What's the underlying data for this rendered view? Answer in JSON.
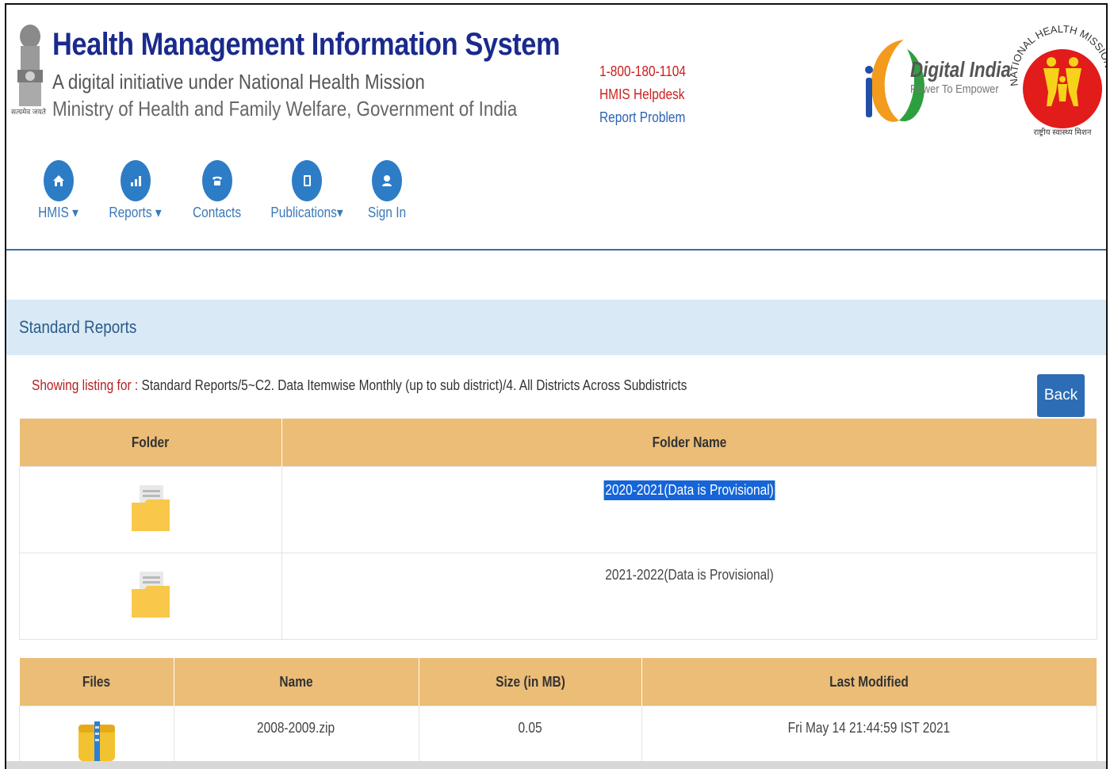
{
  "header": {
    "title": "Health Management Information System",
    "subtitle": "A digital initiative under National Health Mission",
    "ministry": "Ministry of Health and Family Welfare, Government of India",
    "emblem_caption": "सत्यमेव जयते",
    "helpline": {
      "phone": "1-800-180-1104",
      "helpdesk": "HMIS Helpdesk",
      "report_problem": "Report Problem"
    },
    "digital_india": {
      "title": "Digital India",
      "tagline": "Power To Empower"
    },
    "nhm_logo": {
      "text": "NATIONAL HEALTH MISSION",
      "hindi": "राष्ट्रीय स्वास्थ्य मिशन"
    }
  },
  "nav": {
    "items": [
      {
        "label": "HMIS",
        "icon": "home-icon",
        "dropdown": true
      },
      {
        "label": "Reports",
        "icon": "bar-chart-icon",
        "dropdown": true
      },
      {
        "label": "Contacts",
        "icon": "phone-icon",
        "dropdown": false
      },
      {
        "label": "Publications",
        "icon": "book-icon",
        "dropdown": true
      },
      {
        "label": "Sign In",
        "icon": "user-icon",
        "dropdown": false
      }
    ]
  },
  "panel": {
    "title": "Standard Reports",
    "listing_label": "Showing listing for :",
    "listing_path": "Standard Reports/5~C2. Data Itemwise Monthly (up to sub district)/4. All Districts Across Subdistricts",
    "back_label": "Back"
  },
  "folders_table": {
    "headers": [
      "Folder",
      "Folder Name"
    ],
    "rows": [
      {
        "name": "2020-2021(Data is Provisional)",
        "selected": true
      },
      {
        "name": "2021-2022(Data is Provisional)",
        "selected": false
      }
    ]
  },
  "files_table": {
    "headers": [
      "Files",
      "Name",
      "Size (in MB)",
      "Last Modified"
    ],
    "rows": [
      {
        "name": "2008-2009.zip",
        "size": "0.05",
        "modified": "Fri May 14 21:44:59 IST 2021"
      }
    ]
  },
  "colors": {
    "title": "#1a2a8c",
    "nav_icon": "#2d7cc6",
    "table_header": "#ebbd77",
    "panel_head": "#d9eaf6",
    "selection": "#1565d8",
    "back_button": "#2d6db5"
  }
}
